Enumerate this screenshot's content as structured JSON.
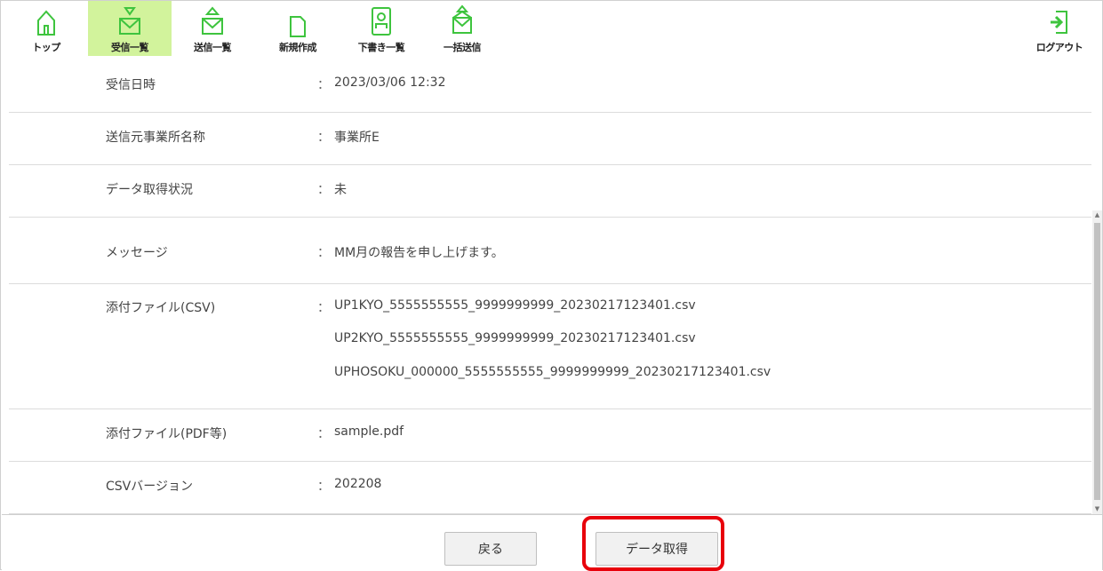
{
  "nav": {
    "items": [
      {
        "label": "トップ",
        "icon": "home-icon"
      },
      {
        "label": "受信一覧",
        "icon": "inbox-mail-icon",
        "active": true
      },
      {
        "label": "送信一覧",
        "icon": "sent-mail-icon"
      },
      {
        "label": "新規作成",
        "icon": "new-document-icon"
      },
      {
        "label": "下書き一覧",
        "icon": "draft-icon"
      },
      {
        "label": "一括送信",
        "icon": "bulk-send-icon"
      }
    ],
    "logout_label": "ログアウト",
    "accent_color": "#3ec43e",
    "active_bg": "#d2f39c"
  },
  "detail": {
    "received_at": {
      "label": "受信日時",
      "value": "2023/03/06 12:32"
    },
    "sender": {
      "label": "送信元事業所名称",
      "value": "事業所E"
    },
    "fetch_status": {
      "label": "データ取得状況",
      "value": "未"
    },
    "message": {
      "label": "メッセージ",
      "value": "MM月の報告を申し上げます。"
    },
    "csv_files": {
      "label": "添付ファイル(CSV)",
      "files": [
        "UP1KYO_5555555555_9999999999_20230217123401.csv",
        "UP2KYO_5555555555_9999999999_20230217123401.csv",
        "UPHOSOKU_000000_5555555555_9999999999_20230217123401.csv"
      ]
    },
    "pdf_files": {
      "label": "添付ファイル(PDF等)",
      "value": "sample.pdf"
    },
    "csv_version": {
      "label": "CSVバージョン",
      "value": "202208"
    },
    "colon": "："
  },
  "buttons": {
    "back": "戻る",
    "fetch": "データ取得"
  },
  "highlight_color": "#e8000b"
}
